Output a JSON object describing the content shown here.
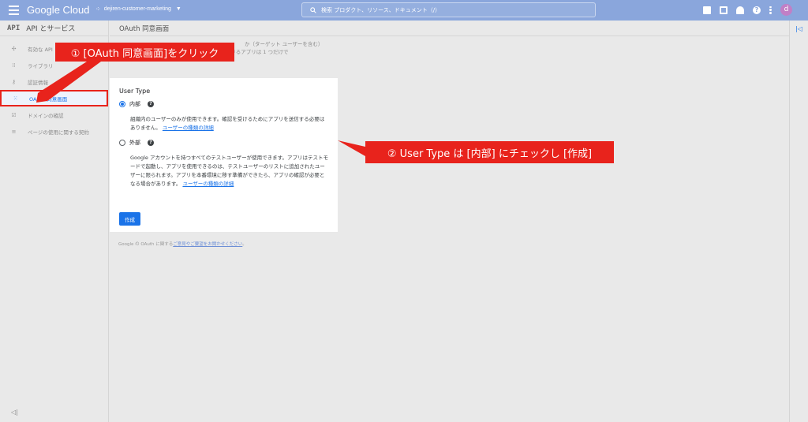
{
  "topbar": {
    "logo": "Google Cloud",
    "project": "dejiren-customer-marketing",
    "search_placeholder": "検索  プロダクト、リソース、ドキュメント（/）",
    "avatar": "d"
  },
  "sidebar": {
    "title_mark": "API",
    "title": "API とサービス",
    "items": [
      {
        "label": "有効な API"
      },
      {
        "label": "ライブラリ"
      },
      {
        "label": "認証情報"
      },
      {
        "label": "OAuth 同意画面"
      },
      {
        "label": "ドメインの確認"
      },
      {
        "label": "ページの使用に関する契約"
      }
    ]
  },
  "main": {
    "page_title": "OAuth 同意画面",
    "desc_line1": "か（ターゲット ユーザーを含む）",
    "desc_line2": "設定します。プロジェクトに関連付けることができるアプリは 1 つだけで",
    "desc_line3": "す。",
    "card": {
      "title": "User Type",
      "internal_label": "内部",
      "internal_help": "組織内のユーザーのみが使用できます。確認を受けるためにアプリを送信する必要はありません。",
      "internal_link": "ユーザーの種類の詳細",
      "external_label": "外部",
      "external_help": "Google アカウントを持つすべてのテストユーザーが使用できます。アプリはテストモードで起動し、アプリを使用できるのは、テストユーザーのリストに追加されたユーザーに限られます。アプリを本番環境に移す準備ができたら、アプリの確認が必要となる場合があります。",
      "external_link": "ユーザーの種類の詳細",
      "create_label": "作成"
    },
    "footer_prefix": "Google の OAuth に関する",
    "footer_link": "ご意見やご要望をお聞かせください",
    "footer_suffix": "。"
  },
  "annotations": {
    "step1": "① [OAuth 同意画面]をクリック",
    "step2": "② User Type は [内部] にチェックし [作成]"
  },
  "colors": {
    "topbar": "#8aa6dc",
    "accent": "#1a73e8",
    "annotation": "#e8231c"
  }
}
